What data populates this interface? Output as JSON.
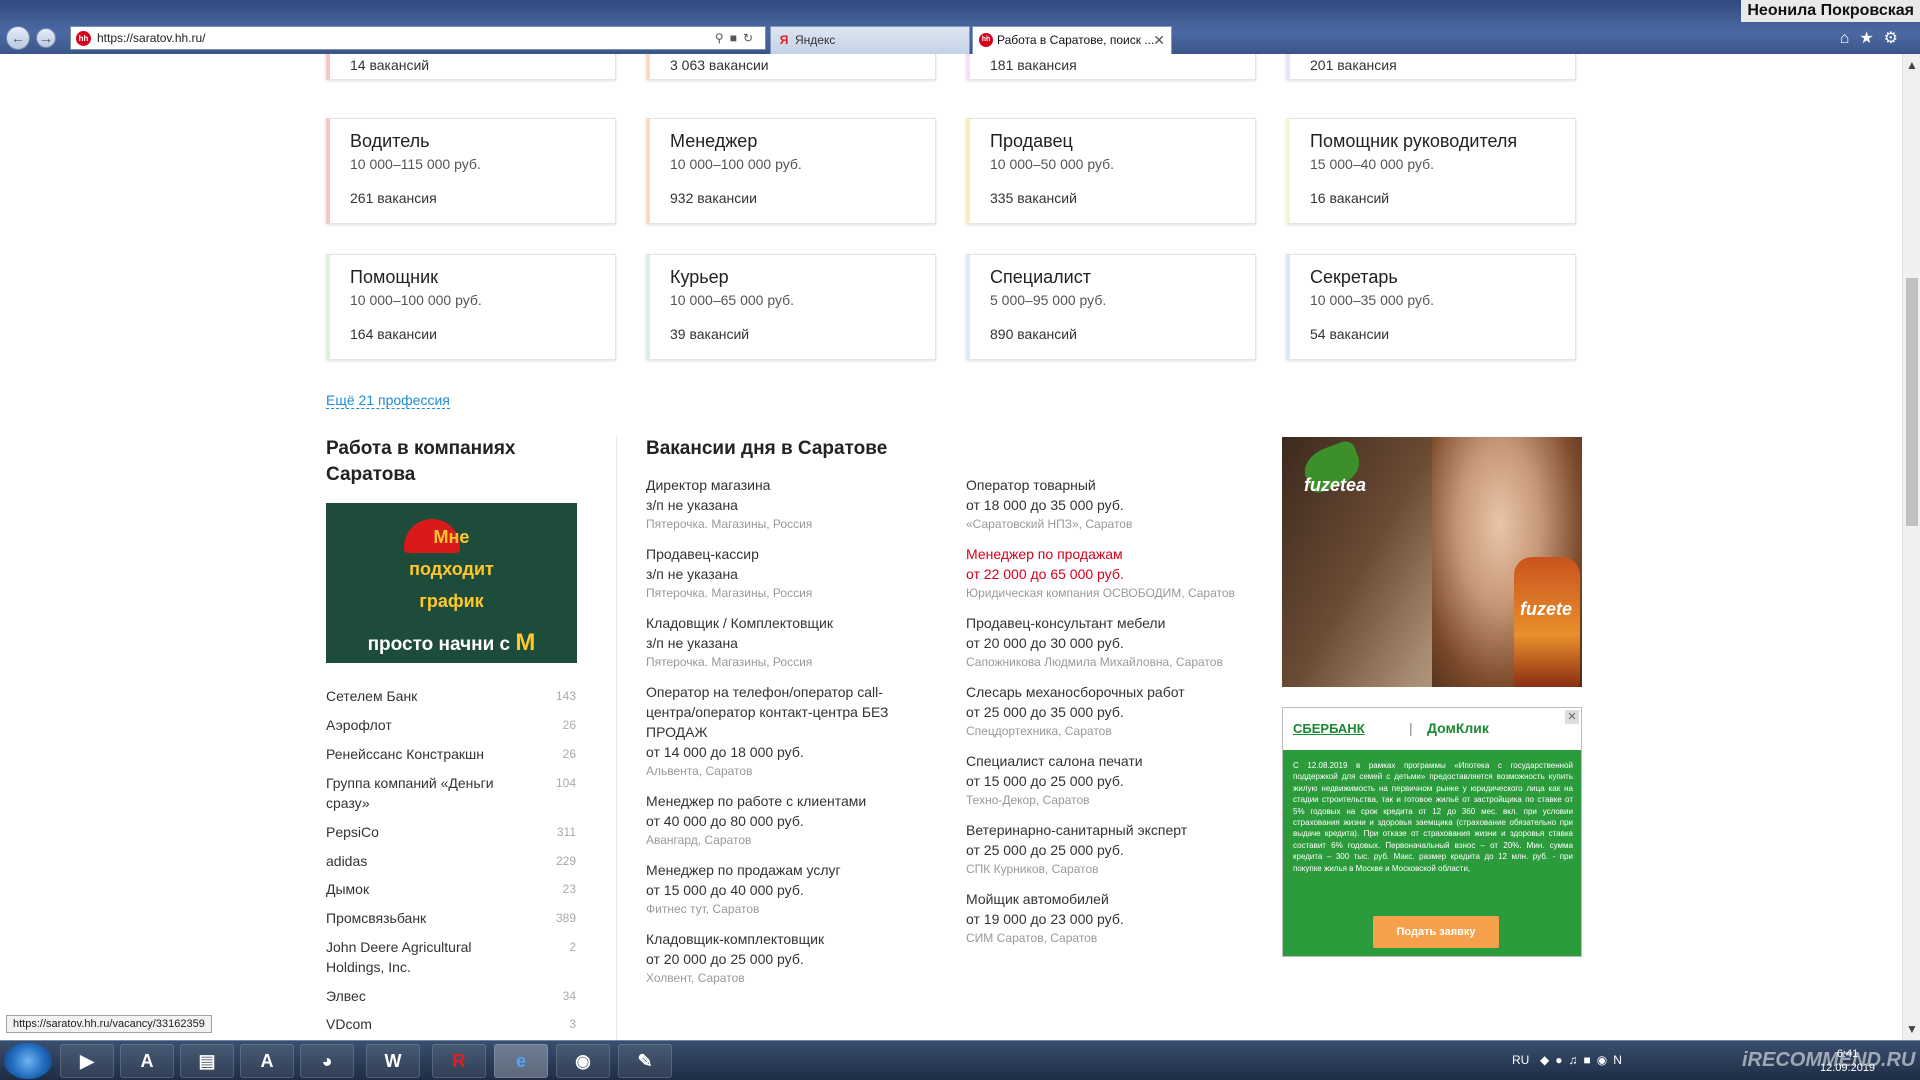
{
  "browser": {
    "url": "https://saratov.hh.ru/",
    "tabs": [
      {
        "title": "Яндекс",
        "icon": "Я"
      },
      {
        "title": "Работа в Саратове, поиск ...",
        "icon": "hh"
      }
    ],
    "user_name": "Неонила Покровская"
  },
  "top_counts": [
    "14 вакансий",
    "3 063 вакансии",
    "181 вакансия",
    "201 вакансия"
  ],
  "professions": [
    {
      "title": "Водитель",
      "salary": "10 000–115 000 руб.",
      "count": "261 вакансия",
      "accent": "#f7c7c7"
    },
    {
      "title": "Менеджер",
      "salary": "10 000–100 000 руб.",
      "count": "932 вакансии",
      "accent": "#fbd9bd"
    },
    {
      "title": "Продавец",
      "salary": "10 000–50 000 руб.",
      "count": "335 вакансий",
      "accent": "#f9ecc2"
    },
    {
      "title": "Помощник руководителя",
      "salary": "15 000–40 000 руб.",
      "count": "16 вакансий",
      "accent": "#f4f5d3"
    },
    {
      "title": "Помощник",
      "salary": "10 000–100 000 руб.",
      "count": "164 вакансии",
      "accent": "#dcf1da"
    },
    {
      "title": "Курьер",
      "salary": "10 000–65 000 руб.",
      "count": "39 вакансий",
      "accent": "#d7efe4"
    },
    {
      "title": "Специалист",
      "salary": "5 000–95 000 руб.",
      "count": "890 вакансий",
      "accent": "#d6eef0"
    },
    {
      "title": "Секретарь",
      "salary": "10 000–35 000 руб.",
      "count": "54 вакансии",
      "accent": "#dbe9f6"
    }
  ],
  "more_professions": "Ещё 21 профессия",
  "companies_section": {
    "title_line1": "Работа в компаниях",
    "title_line2": "Саратова",
    "banner": {
      "line1": "Мне",
      "line2": "подходит",
      "line3": "график",
      "line4": "просто начни с",
      "arch": "M"
    },
    "companies": [
      {
        "name": "Сетелем Банк",
        "count": "143"
      },
      {
        "name": "Аэрофлот",
        "count": "26"
      },
      {
        "name": "Ренейссанс Констракшн",
        "count": "26"
      },
      {
        "name": "Группа компаний «Деньги сразу»",
        "count": "104"
      },
      {
        "name": "PepsiCo",
        "count": "311"
      },
      {
        "name": "adidas",
        "count": "229"
      },
      {
        "name": "Дымок",
        "count": "23"
      },
      {
        "name": "Промсвязьбанк",
        "count": "389"
      },
      {
        "name": "John Deere Agricultural Holdings, Inc.",
        "count": "2"
      },
      {
        "name": "Элвес",
        "count": "34"
      },
      {
        "name": "VDcom",
        "count": "3"
      }
    ]
  },
  "vacancies_section": {
    "title": "Вакансии дня в Саратове",
    "left": [
      {
        "name": "Директор магазина",
        "salary": "з/п не указана",
        "company": "Пятерочка. Магазины, Россия"
      },
      {
        "name": "Продавец-кассир",
        "salary": "з/п не указана",
        "company": "Пятерочка. Магазины, Россия"
      },
      {
        "name": "Кладовщик / Комплектовщик",
        "salary": "з/п не указана",
        "company": "Пятерочка. Магазины, Россия"
      },
      {
        "name": "Оператор на телефон/оператор call-центра/оператор контакт-центра БЕЗ ПРОДАЖ",
        "salary": "от 14 000 до 18 000 руб.",
        "company": "Альвента, Саратов"
      },
      {
        "name": "Менеджер по работе с клиентами",
        "salary": "от 40 000 до 80 000 руб.",
        "company": "Авангард, Саратов"
      },
      {
        "name": "Менеджер по продажам услуг",
        "salary": "от 15 000 до 40 000 руб.",
        "company": "Фитнес тут, Саратов"
      },
      {
        "name": "Кладовщик-комплектовщик",
        "salary": "от 20 000 до 25 000 руб.",
        "company": "Холвент, Саратов"
      }
    ],
    "right": [
      {
        "name": "Оператор товарный",
        "salary": "от 18 000 до 35 000 руб.",
        "company": "«Саратовский НПЗ», Саратов"
      },
      {
        "name": "Менеджер по продажам",
        "salary": "от 22 000 до 65 000 руб.",
        "company": "Юридическая компания ОСВОБОДИМ, Саратов",
        "highlight": true
      },
      {
        "name": "Продавец-консультант мебели",
        "salary": "от 20 000 до 30 000 руб.",
        "company": "Сапожникова Людмила Михайловна, Саратов"
      },
      {
        "name": "Слесарь механосборочных работ",
        "salary": "от 25 000 до 35 000 руб.",
        "company": "Спецдортехника, Саратов"
      },
      {
        "name": "Специалист салона печати",
        "salary": "от 15 000 до 25 000 руб.",
        "company": "Техно-Декор, Саратов"
      },
      {
        "name": "Ветеринарно-санитарный эксперт",
        "salary": "от 25 000 до 25 000 руб.",
        "company": "СПК Курников, Саратов"
      },
      {
        "name": "Мойщик автомобилей",
        "salary": "от 19 000 до 23 000 руб.",
        "company": "СИМ Саратов, Саратов"
      }
    ]
  },
  "ads": {
    "fuze": {
      "logo": "fuzetea",
      "bottle_text": "fuzete"
    },
    "sber": {
      "brand1": "СБЕРБАНК",
      "separator": "|",
      "brand2": "ДомКлик",
      "close": "✕",
      "text": "С 12.08.2019 в рамках программы «Ипотека с государственной поддержкой для семей с детьми» предоставляется возможность купить жилую недвижимость на первичном рынке у юридического лица как на стадии строительства, так и готовое жильё от застройщика по ставке от 5% годовых на срок кредита от 12 до 360 мес. вкл. при условии страхования жизни и здоровья заемщика (страхование обязательно при выдаче кредита). При отказе от страхования жизни и здоровья ставка составит 6% годовых. Первоначальный взнос – от 20%. Мин. сумма кредита – 300 тыс. руб. Макс. размер кредита до 12 млн. руб. - при покупке жилья в Москве и Московской области,",
      "button": "Подать заявку"
    }
  },
  "status_url": "https://saratov.hh.ru/vacancy/33162359",
  "taskbar": {
    "apps": [
      {
        "name": "media-player",
        "label": "▶"
      },
      {
        "name": "acrobat",
        "label": "A"
      },
      {
        "name": "explorer",
        "label": "▤"
      },
      {
        "name": "spreadsheet",
        "label": "A"
      },
      {
        "name": "picasa",
        "label": "◕"
      },
      {
        "name": "word",
        "label": "W"
      },
      {
        "name": "r-app",
        "label": "R"
      },
      {
        "name": "internet-explorer",
        "label": "e"
      },
      {
        "name": "chrome",
        "label": "◉"
      },
      {
        "name": "control",
        "label": "✎"
      }
    ],
    "lang": "RU",
    "time": "6:41",
    "date": "12.09.2019",
    "watermark": "iRECOMMEND.RU"
  }
}
